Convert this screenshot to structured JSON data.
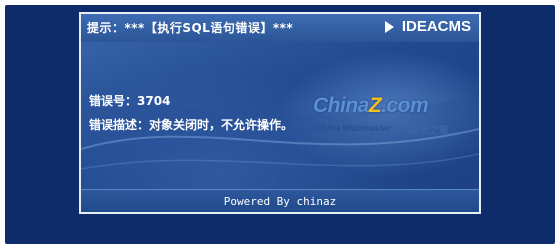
{
  "window": {
    "title": "提示：***【执行SQL语句错误】***",
    "brand": "IDEACMS"
  },
  "error": {
    "code_label": "错误号：",
    "code_value": "3704",
    "desc_label": "错误描述：",
    "desc_value": "对象关闭时，不允许操作。"
  },
  "logo": {
    "main_prefix": "China",
    "main_z": "Z",
    "main_suffix": ".com",
    "sub_en": "China Webmaster",
    "sub_cn": "站长之家"
  },
  "footer": {
    "text": "Powered By chinaz"
  },
  "colors": {
    "background": "#0e2b6a",
    "panel": "#21498f",
    "logo_accent": "#f2c21a"
  },
  "icons": {
    "brand_marker": "play-icon"
  }
}
